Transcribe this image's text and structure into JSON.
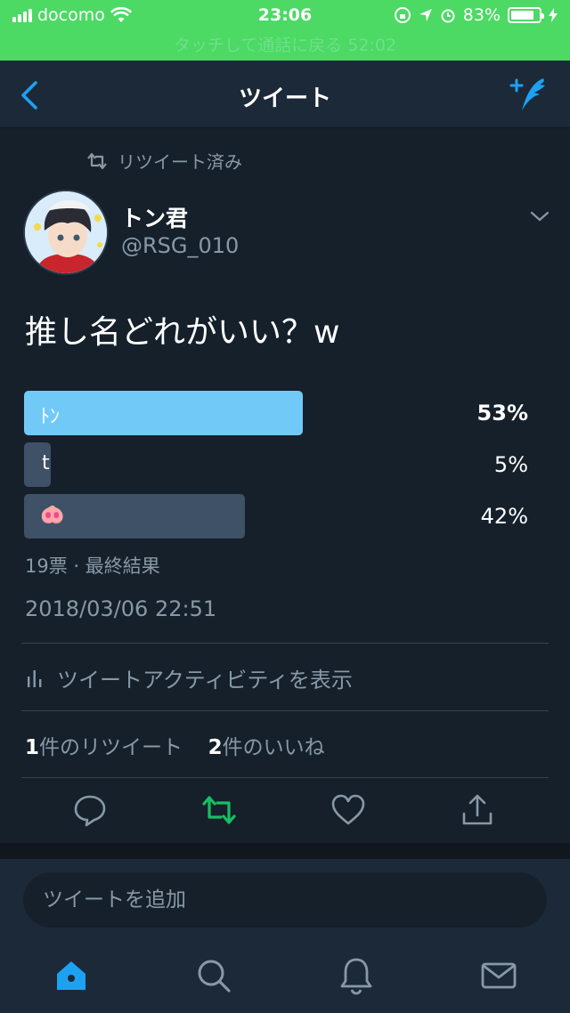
{
  "status_bar": {
    "carrier": "docomo",
    "time": "23:06",
    "battery": "83%",
    "battery_level": 0.83,
    "call_banner": "タッチして通話に戻る 52:02"
  },
  "nav": {
    "title": "ツイート"
  },
  "tweet": {
    "retweeted_label": "リツイート済み",
    "author_name": "トン君",
    "author_handle": "@RSG_010",
    "text": "推し名どれがいい？w",
    "poll": {
      "options": [
        {
          "label": "ﾄﾝ",
          "percent_text": "53%",
          "percent": 53,
          "winner": true
        },
        {
          "label": "t",
          "percent_text": "5%",
          "percent": 5,
          "winner": false
        },
        {
          "label": "🐽",
          "percent_text": "42%",
          "percent": 42,
          "winner": false
        }
      ],
      "meta": "19票 · 最終結果"
    },
    "timestamp": "2018/03/06 22:51",
    "activity_label": "ツイートアクティビティを表示",
    "retweet_count": "1",
    "retweet_label": "件のリツイート",
    "like_count": "2",
    "like_label": "件のいいね"
  },
  "composer": {
    "placeholder": "ツイートを追加"
  },
  "colors": {
    "background": "#15202b",
    "status_green": "#4cd964",
    "accent_blue": "#1da1f2",
    "poll_winner": "#71c9f8",
    "retweet_green": "#17bf63",
    "muted_text": "#8899a6"
  },
  "icons": [
    "back-chevron-icon",
    "compose-tweet-icon",
    "retweet-icon",
    "reply-icon",
    "like-icon",
    "share-icon",
    "home-icon",
    "search-icon",
    "notifications-icon",
    "messages-icon",
    "activity-bars-icon"
  ]
}
